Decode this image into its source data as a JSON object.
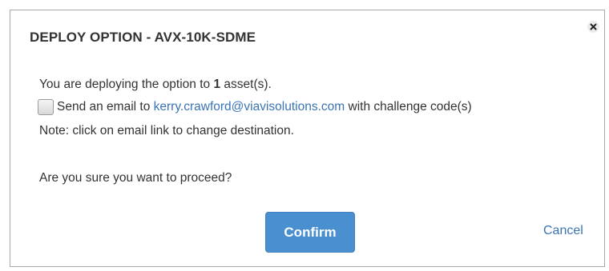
{
  "dialog": {
    "title": "DEPLOY OPTION - AVX-10K-SDME",
    "close_icon": "close-icon",
    "message_prefix": "You are deploying the option to ",
    "asset_count": "1",
    "message_suffix": " asset(s).",
    "email_option": {
      "checked": false,
      "prefix": "Send an email to ",
      "email": "kerry.crawford@viavisolutions.com",
      "suffix": " with challenge code(s)"
    },
    "note": "Note: click on email link to change destination.",
    "question": "Are you sure you want to proceed?",
    "confirm_label": "Confirm",
    "cancel_label": "Cancel"
  },
  "colors": {
    "primary_button": "#4a8fcf",
    "link": "#3a74b5",
    "text": "#333333",
    "border": "#a8a8a8"
  }
}
